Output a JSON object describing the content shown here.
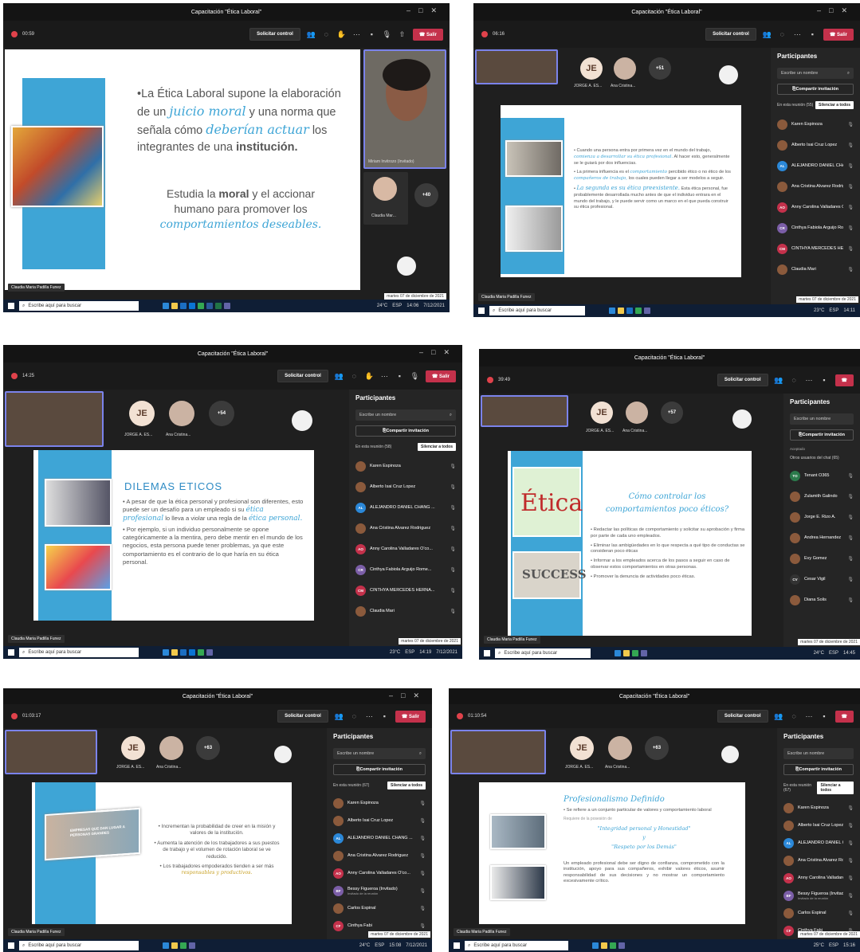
{
  "common": {
    "window_title": "Capacitación \"Ética Laboral\"",
    "control_button": "Solicitar control",
    "leave_button": "Salir",
    "search_placeholder": "Escribe aquí para buscar",
    "participants_title": "Participantes",
    "participants_search": "Escribe un nombre",
    "invite_button": "Compartir invitación",
    "mute_all_button": "Silenciar a todos",
    "presenter_chip": "Claudia Maria Padilla Funez",
    "jorge_label": "JORGE A. ES...",
    "ana_label": "Ana Cristina...",
    "jorge_initials": "JE",
    "date_stamp": "martes 07 de diciembre de 2021",
    "taskbar_date": "7/12/2021",
    "lang": "ESP"
  },
  "panels": [
    {
      "timer": "00:59",
      "clock": "14:06",
      "temp": "24°C",
      "more": "+40",
      "guest_label": "Miriam Invitrozo (Invitado)",
      "claudia_label": "Claudia Mar..."
    },
    {
      "timer": "06:16",
      "clock": "14:11",
      "temp": "23°C",
      "more": "+51",
      "section": "En esta reunión (55)"
    },
    {
      "timer": "14:25",
      "clock": "14:19",
      "temp": "23°C",
      "more": "+54",
      "section": "En esta reunión (58)"
    },
    {
      "timer": "39:49",
      "clock": "14:45",
      "temp": "24°C",
      "more": "+57",
      "section": "Otros usuarios del chat (65)",
      "accepted": "Aceptado"
    },
    {
      "timer": "01:03:17",
      "clock": "15:08",
      "temp": "24°C",
      "more": "+63",
      "section": "En esta reunión (67)"
    },
    {
      "timer": "01:10:54",
      "clock": "15:16",
      "temp": "25°C",
      "more": "+63",
      "section": "En esta reunión (67)"
    }
  ],
  "participants_main": [
    {
      "name": "Karen Espinoza",
      "color": "#8b5a3c"
    },
    {
      "name": "Alberto Isai Cruz Lopez",
      "color": "#8b5a3c"
    },
    {
      "name": "ALEJANDRO DANIEL CHANG ...",
      "color": "#2b88d8",
      "initials": "AL"
    },
    {
      "name": "Ana Cristina Alvarez Rodriguez",
      "color": "#8b5a3c"
    },
    {
      "name": "Anny Carolina Valladares O'co...",
      "color": "#c4314b",
      "initials": "AO"
    },
    {
      "name": "Cinthya Fabiola Arguijo Rome...",
      "color": "#7b5ea7",
      "initials": "CR"
    },
    {
      "name": "CINTHYA MERCEDES HERNA...",
      "color": "#c4314b",
      "initials": "CM"
    },
    {
      "name": "Claudia Mari",
      "color": "#8b5a3c"
    }
  ],
  "participants_p4": [
    {
      "name": "Tenant O365",
      "color": "#2b7a4b",
      "initials": "TO"
    },
    {
      "name": "Zulamith Galindo",
      "color": "#8b5a3c"
    },
    {
      "name": "Jorge E. Rizo A.",
      "color": "#8b5a3c"
    },
    {
      "name": "Andrea Hernandez",
      "color": "#8b5a3c"
    },
    {
      "name": "Evy Gomez",
      "color": "#8b5a3c"
    },
    {
      "name": "Cesar Vigil",
      "color": "#333",
      "initials": "CV"
    },
    {
      "name": "Diana Solis",
      "color": "#8b5a3c"
    }
  ],
  "participants_p5": [
    {
      "name": "Karen Espinoza",
      "color": "#8b5a3c"
    },
    {
      "name": "Alberto Isai Cruz Lopez",
      "color": "#8b5a3c"
    },
    {
      "name": "ALEJANDRO DANIEL CHANG ...",
      "color": "#2b88d8",
      "initials": "AL"
    },
    {
      "name": "Ana Cristina Alvarez Rodriguez",
      "color": "#8b5a3c"
    },
    {
      "name": "Anny Carolina Valladares O'co...",
      "color": "#c4314b",
      "initials": "AO"
    },
    {
      "name": "Bessy Figueroa (Invitado)",
      "sub": "Invitado de la reunión",
      "color": "#7b5ea7",
      "initials": "BF"
    },
    {
      "name": "Carlos Espinal",
      "color": "#8b5a3c"
    },
    {
      "name": "Cinthya Fabi",
      "color": "#c4314b",
      "initials": "CF"
    }
  ],
  "participants_p6": [
    {
      "name": "Karen Espinoza",
      "color": "#8b5a3c"
    },
    {
      "name": "Alberto Isai Cruz Lopez",
      "color": "#8b5a3c"
    },
    {
      "name": "ALEJANDRO DANIEL CHANG ...",
      "color": "#2b88d8",
      "initials": "AL"
    },
    {
      "name": "Ana Cristina Alvarez Rodriguez",
      "color": "#8b5a3c"
    },
    {
      "name": "Anny Carolina Valladares O'co",
      "color": "#c4314b",
      "initials": "AO"
    },
    {
      "name": "Bessy Figueroa (Invitado)",
      "sub": "Invitado de la reunión",
      "color": "#7b5ea7",
      "initials": "BF"
    },
    {
      "name": "Carlos Espinal",
      "color": "#8b5a3c"
    },
    {
      "name": "Cinthya Fabi",
      "color": "#c4314b",
      "initials": "CF"
    }
  ],
  "slide1": {
    "p1_a": "La Ética Laboral supone la elaboración de un",
    "p1_em1": "juicio moral",
    "p1_b": "y una norma que señala cómo",
    "p1_em2": "deberían actuar",
    "p1_c": "los integrantes de una",
    "p1_strong": "institución.",
    "p2_a": "Estudia la",
    "p2_strong": "moral",
    "p2_b": "y el accionar humano para promover los",
    "p2_em": "comportamientos deseables."
  },
  "slide2": {
    "b1_a": "Cuando una persona entra por primera vez en el mundo del trabajo,",
    "b1_em": "comienza a desarrollar su ética profesional.",
    "b1_b": "Al hacer esto, generalmente se le guiará por dos influencias.",
    "b2_a": "La primera influencia es el",
    "b2_em1": "comportamiento",
    "b2_b": "percibido ético o no ético de los",
    "b2_em2": "compañeros de trabajo,",
    "b2_c": "los cuales pueden llegar a ser modelos a seguir.",
    "b3_em": "La segunda es su ética preexistente.",
    "b3_b": "Esta ética personal, fue probablemente desarrollada mucho antes de que el individuo entrara en el mundo del trabajo, y le puede servir como un marco en el que pueda construir su ética profesional."
  },
  "slide3": {
    "title": "DILEMAS ETICOS",
    "b1_a": "A pesar de que la ética personal y profesional son diferentes, esto puede ser un desafío para un empleado si su",
    "b1_em1": "ética profesional",
    "b1_b": "lo lleva a violar una regla de la",
    "b1_em2": "ética personal.",
    "b2": "Por ejemplo, si un individuo personalmente se opone categóricamente a la mentira, pero debe mentir en el mundo de los negocios, esta persona puede tener problemas, ya que este comportamiento es el contrario de lo que haría en su ética personal."
  },
  "slide4": {
    "title": "Cómo controlar los comportamientos poco éticos?",
    "b1": "Redactar las políticas de comportamiento y solicitar su aprobación y firma por parte de cada uno empleados.",
    "b2": "Eliminar las ambigüedades en lo que respecta a qué tipo de conductas se consideran poco éticas",
    "b3": "Informar a los empleados acerca de los pasos a seguir en caso de observar estos comportamientos en otras personas.",
    "b4": "Promover la denuncia de actividades poco éticas.",
    "etica_word": "Ética",
    "success_word": "SUCCESS"
  },
  "slide5": {
    "b1": "Incrementan la probabilidad de creer en la misión y valores de la institución.",
    "b2": "Aumenta la atención de los trabajadores a sus puestos de trabajo y el volumen de rotación laboral se ve reducido.",
    "b3_a": "Los trabajadores empoderados tienden a ser más",
    "b3_em": "responsables y productivos.",
    "photo_text": "EMPRESAS QUE DAN LUGAR A PERSONAS GRANDES"
  },
  "slide6": {
    "title": "Profesionalismo Definido",
    "b1": "Se refiere a un conjunto particular de valores y comportamiento laboral",
    "req": "Requiere de la posesión de",
    "q1": "\"Integridad personal y Honestidad\"",
    "y": "y",
    "q2": "\"Respeto por los Demás\"",
    "para": "Un empleado profesional debe ser digno de confianza, comprometido con la institución, apoyo para sus compañeros, exhibir valores éticos, asumir responsabilidad de sus decisiones y no mostrar un comportamiento excesivamente crítico."
  },
  "colors": {
    "accent": "#3ea5d6",
    "leave": "#c4314b",
    "teams_purple": "#7b83eb"
  }
}
